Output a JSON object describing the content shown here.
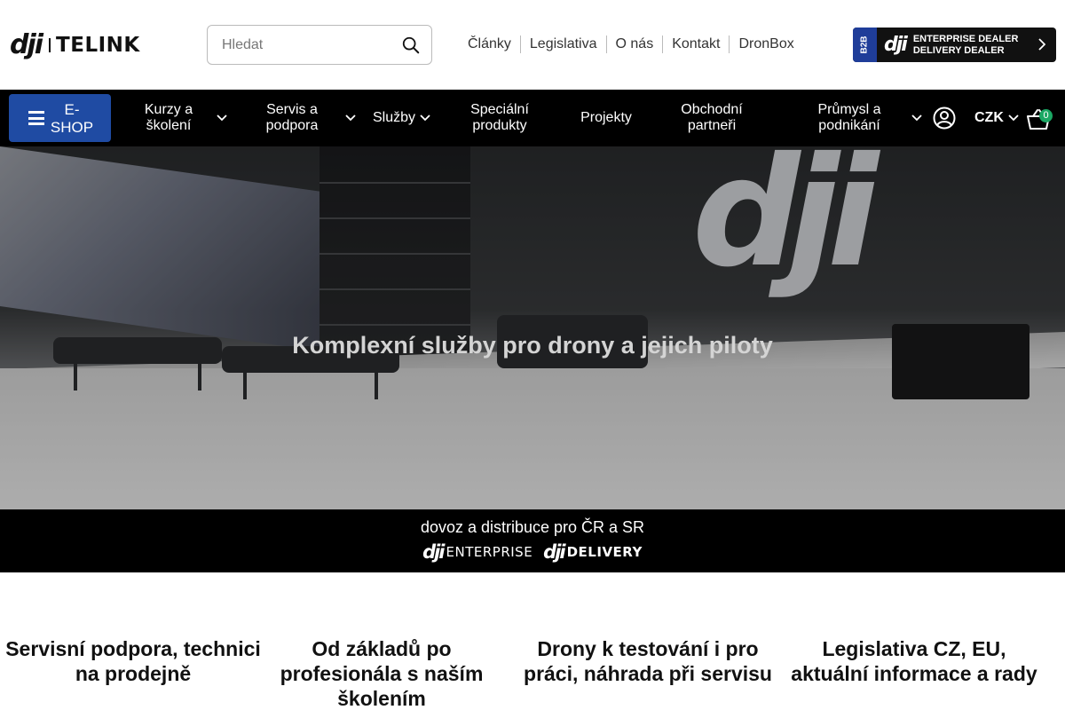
{
  "header": {
    "logo_mark": "dji",
    "logo_brand": "TELINK",
    "search": {
      "placeholder": "Hledat",
      "value": ""
    },
    "links": [
      "Články",
      "Legislativa",
      "O nás",
      "Kontakt",
      "DronBox"
    ],
    "b2b_banner": {
      "tag": "B2B",
      "mark": "dji",
      "line1": "ENTERPRISE DEALER",
      "line2": "DELIVERY DEALER"
    }
  },
  "nav": {
    "eshop_label": "E-SHOP",
    "items": [
      {
        "label": "Kurzy a školení",
        "has_dropdown": true
      },
      {
        "label": "Servis a podpora",
        "has_dropdown": true
      },
      {
        "label": "Služby",
        "has_dropdown": true
      },
      {
        "label": "Speciální produkty",
        "has_dropdown": false
      },
      {
        "label": "Projekty",
        "has_dropdown": false
      },
      {
        "label": "Obchodní partneři",
        "has_dropdown": false
      },
      {
        "label": "Průmysl a podnikání",
        "has_dropdown": true
      }
    ],
    "currency": "CZK",
    "cart_count": "0"
  },
  "hero": {
    "title": "Komplexní služby pro drony a jejich piloty",
    "sign_text": "dji"
  },
  "distribution": {
    "text": "dovoz a distribuce pro ČR a SR",
    "logo1_mark": "dji",
    "logo1_word": "ENTERPRISE",
    "logo2_mark": "dji",
    "logo2_word": "DELIVERY"
  },
  "features": [
    "Servisní podpora, technici na prodejně",
    "Od základů po profesionála s naším školením",
    "Drony k testování i pro práci, náhrada při servisu",
    "Legislativa CZ, EU, aktuální informace a rady"
  ],
  "colors": {
    "eshop_button": "#1f4ba3",
    "nav_background": "#000000",
    "cart_badge": "#1ba864",
    "b2b_tag": "#1f3d99"
  },
  "icons": [
    "search-icon",
    "menu-icon",
    "chevron-down-icon",
    "user-icon",
    "cart-icon",
    "chevron-right-icon"
  ]
}
